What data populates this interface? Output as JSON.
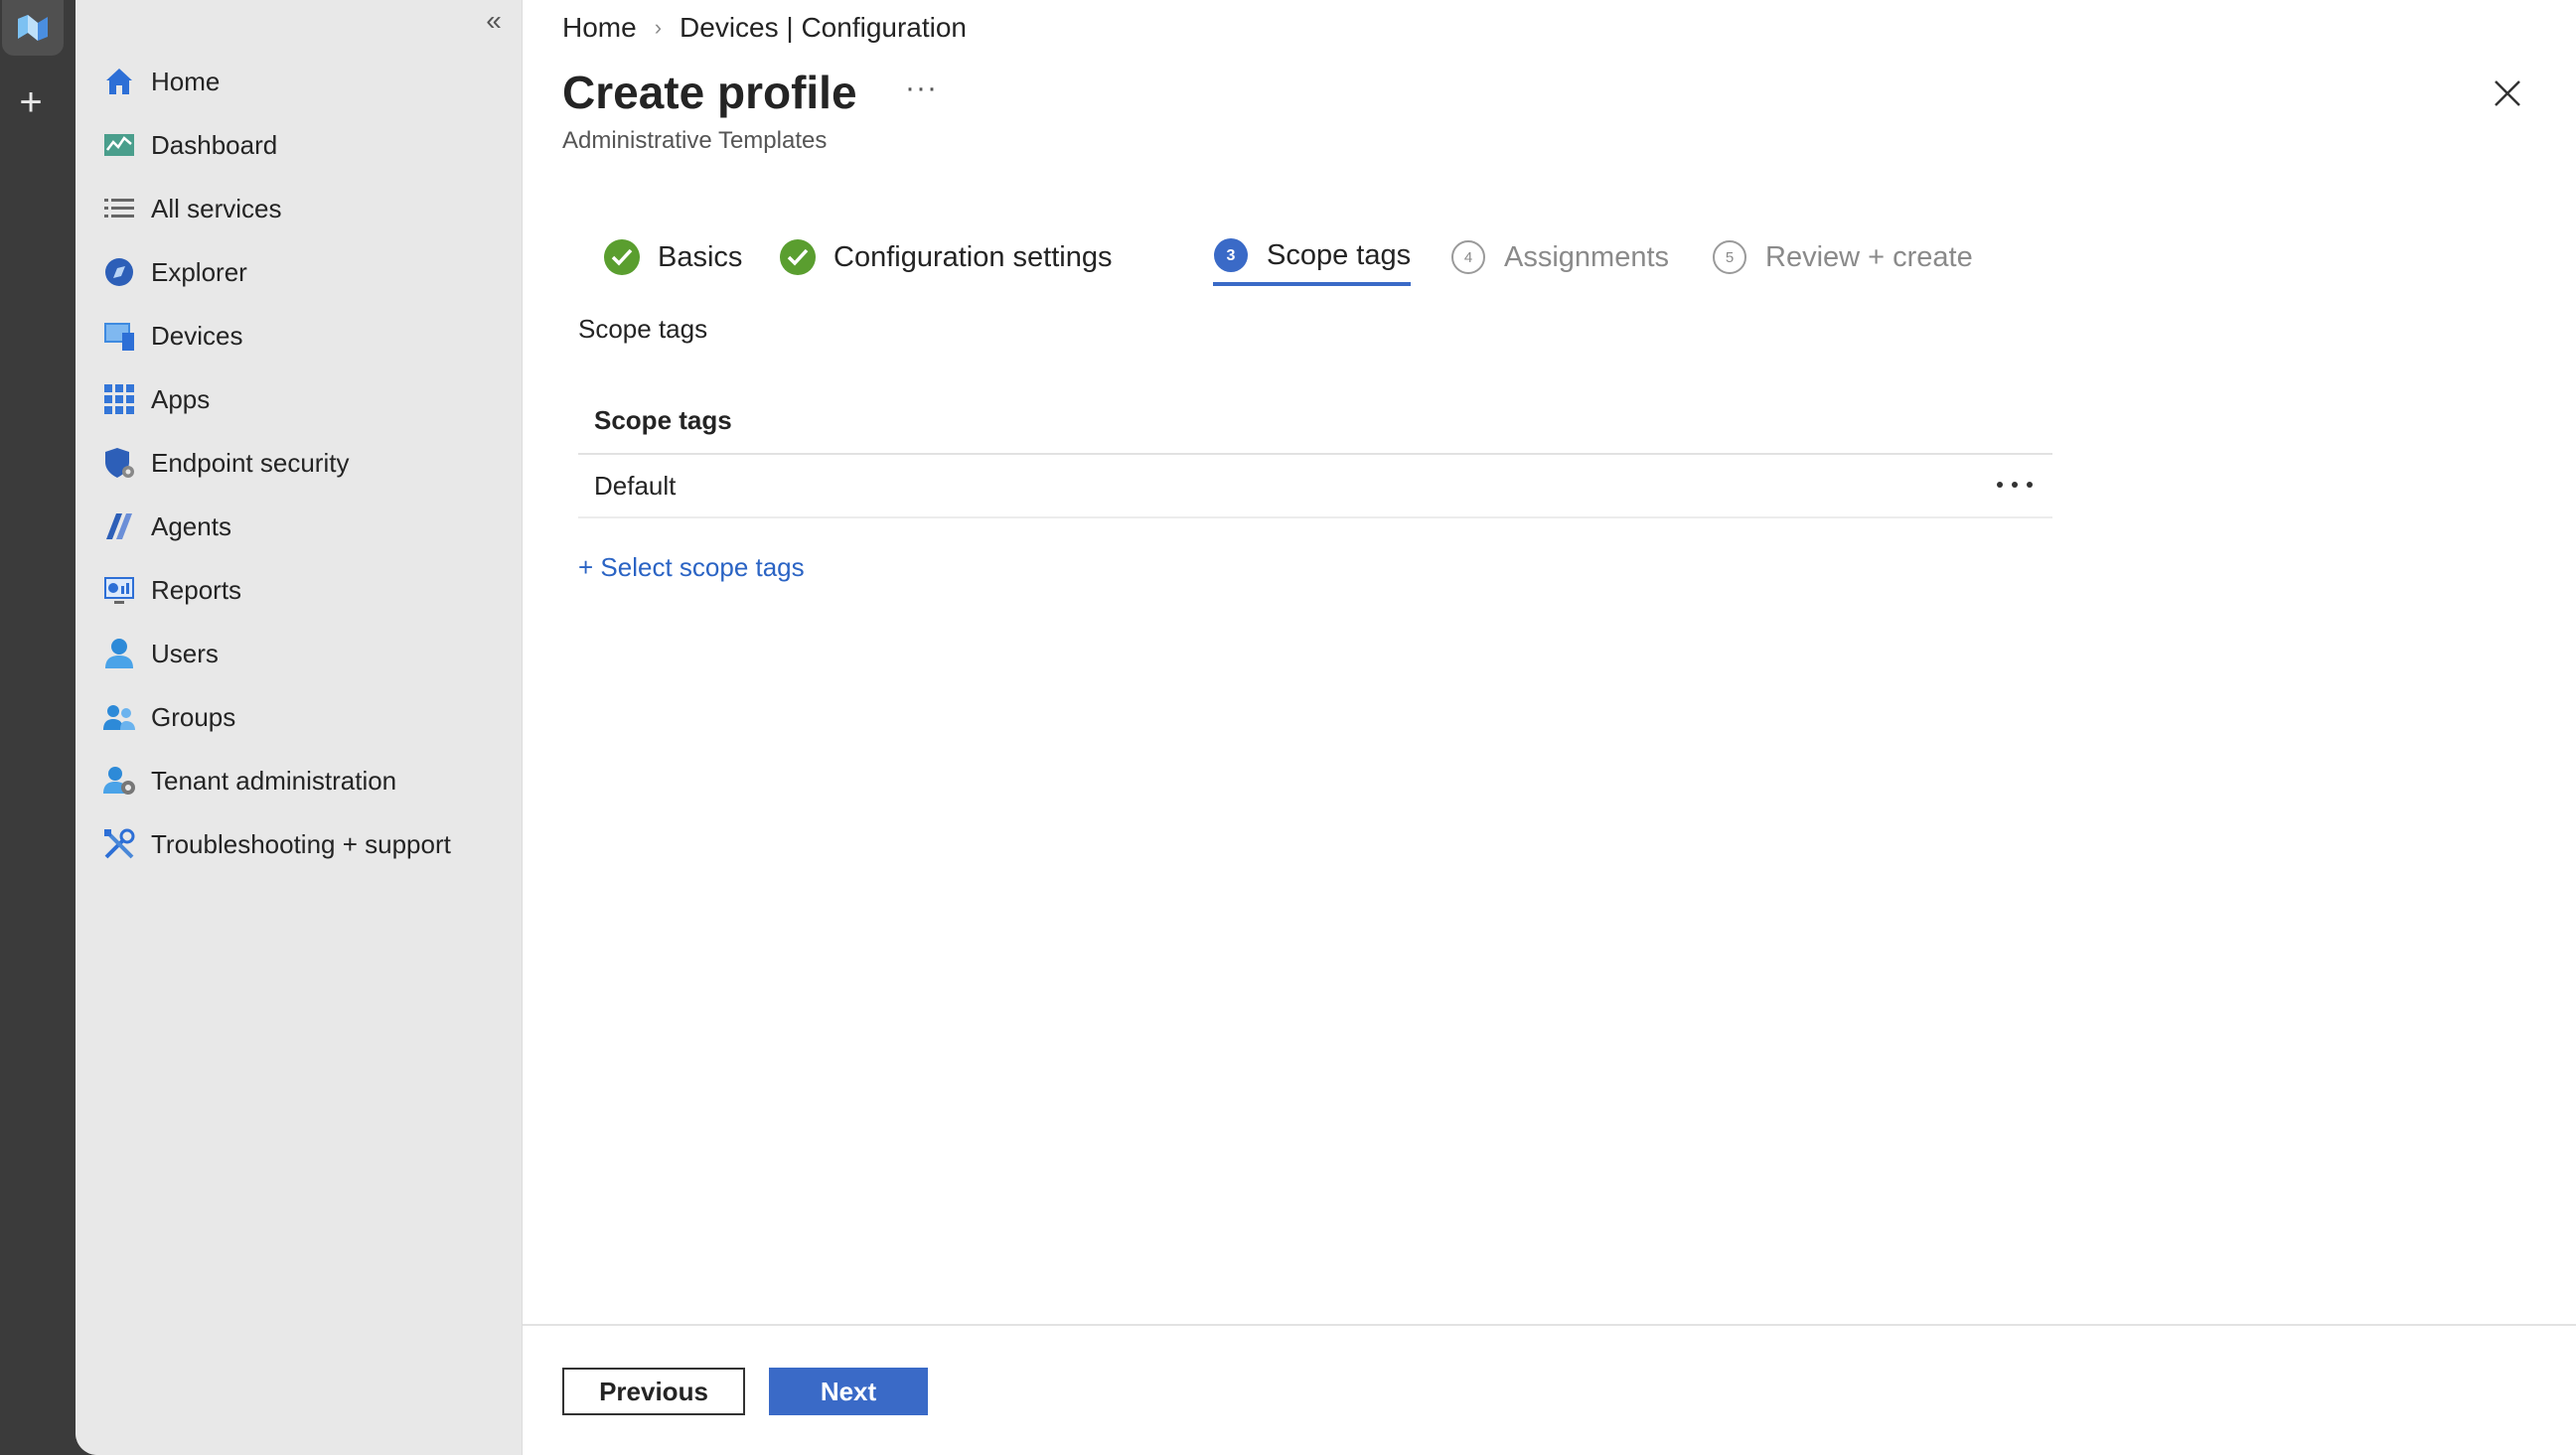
{
  "rail": {
    "plus_label": "+"
  },
  "sidebar": {
    "collapse_label": "«",
    "items": [
      {
        "label": "Home",
        "icon": "home-icon"
      },
      {
        "label": "Dashboard",
        "icon": "dashboard-icon"
      },
      {
        "label": "All services",
        "icon": "list-icon"
      },
      {
        "label": "Explorer",
        "icon": "explorer-icon"
      },
      {
        "label": "Devices",
        "icon": "devices-icon"
      },
      {
        "label": "Apps",
        "icon": "apps-grid-icon"
      },
      {
        "label": "Endpoint security",
        "icon": "shield-gear-icon"
      },
      {
        "label": "Agents",
        "icon": "agents-icon"
      },
      {
        "label": "Reports",
        "icon": "reports-icon"
      },
      {
        "label": "Users",
        "icon": "user-icon"
      },
      {
        "label": "Groups",
        "icon": "groups-icon"
      },
      {
        "label": "Tenant administration",
        "icon": "tenant-admin-icon"
      },
      {
        "label": "Troubleshooting + support",
        "icon": "tools-icon"
      }
    ]
  },
  "breadcrumb": {
    "home": "Home",
    "separator": "›",
    "current": "Devices | Configuration"
  },
  "header": {
    "title": "Create profile",
    "more": "···",
    "subtitle": "Administrative Templates"
  },
  "steps": [
    {
      "number": "1",
      "label": "Basics",
      "state": "completed"
    },
    {
      "number": "2",
      "label": "Configuration settings",
      "state": "completed"
    },
    {
      "number": "3",
      "label": "Scope tags",
      "state": "active"
    },
    {
      "number": "4",
      "label": "Assignments",
      "state": "pending"
    },
    {
      "number": "5",
      "label": "Review + create",
      "state": "pending"
    }
  ],
  "scope": {
    "section_label": "Scope tags",
    "column_header": "Scope tags",
    "rows": [
      "Default"
    ],
    "select_link": "+ Select scope tags"
  },
  "footer": {
    "previous_label": "Previous",
    "next_label": "Next"
  },
  "colors": {
    "accent": "#3a6ac7",
    "success": "#5a9e2f",
    "link": "#2b64c4",
    "sidebar_bg": "#e8e8e8",
    "rail_bg": "#3b3b3b"
  }
}
